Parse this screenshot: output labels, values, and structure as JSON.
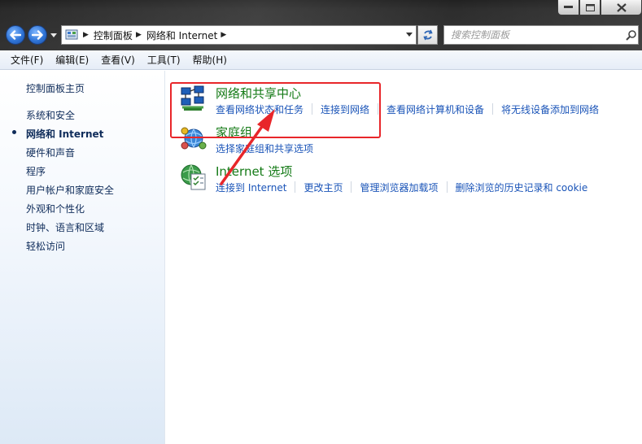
{
  "window": {
    "controls": [
      "minimize",
      "maximize",
      "close"
    ]
  },
  "addressbar": {
    "breadcrumbs": [
      "控制面板",
      "网络和 Internet"
    ]
  },
  "search": {
    "placeholder": "搜索控制面板"
  },
  "menu": [
    {
      "label": "文件(F)"
    },
    {
      "label": "编辑(E)"
    },
    {
      "label": "查看(V)"
    },
    {
      "label": "工具(T)"
    },
    {
      "label": "帮助(H)"
    }
  ],
  "sidebar": {
    "home": "控制面板主页",
    "items": [
      {
        "label": "系统和安全"
      },
      {
        "label": "网络和 Internet"
      },
      {
        "label": "硬件和声音"
      },
      {
        "label": "程序"
      },
      {
        "label": "用户帐户和家庭安全"
      },
      {
        "label": "外观和个性化"
      },
      {
        "label": "时钟、语言和区域"
      },
      {
        "label": "轻松访问"
      }
    ]
  },
  "categories": [
    {
      "title": "网络和共享中心",
      "icon": "network-sharing-icon",
      "links": [
        "查看网络状态和任务",
        "连接到网络",
        "查看网络计算机和设备",
        "将无线设备添加到网络"
      ]
    },
    {
      "title": "家庭组",
      "icon": "homegroup-icon",
      "links": [
        "选择家庭组和共享选项"
      ]
    },
    {
      "title": "Internet 选项",
      "icon": "internet-options-icon",
      "links": [
        "连接到 Internet",
        "更改主页",
        "管理浏览器加载项",
        "删除浏览的历史记录和 cookie"
      ]
    }
  ],
  "colors": {
    "category_title": "#147a16",
    "link": "#1a54b8",
    "annotation": "#e8262a"
  }
}
